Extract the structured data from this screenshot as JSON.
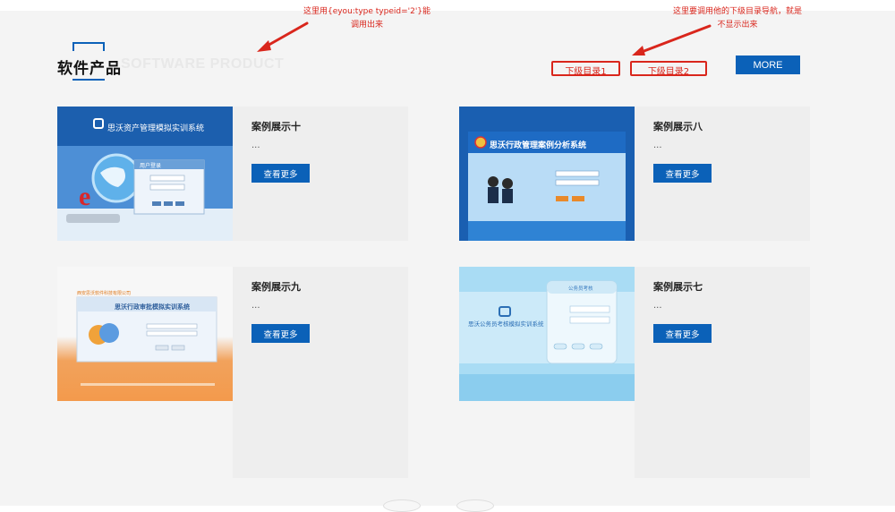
{
  "section": {
    "title_cn": "软件产品",
    "title_en": "SOFTWARE PRODUCT",
    "more_label": "MORE",
    "subnav": [
      "下级目录1",
      "下级目录2"
    ]
  },
  "annotations": {
    "left_note_line1": "这里用{eyou:type typeid='2'}能",
    "left_note_line2": "调用出来",
    "right_note_line1": "这里要调用他的下级目录导航，就是",
    "right_note_line2": "不显示出来"
  },
  "cards": [
    {
      "name": "案例展示十",
      "desc": "...",
      "button": "查看更多",
      "thumb_title": "思沃资产管理模拟实训系统",
      "login_title": "用户登录"
    },
    {
      "name": "案例展示八",
      "desc": "...",
      "button": "查看更多",
      "thumb_title": "思沃行政管理案例分析系统"
    },
    {
      "name": "案例展示九",
      "desc": "...",
      "button": "查看更多",
      "thumb_top_text": "西安思沃软件科技有限公司",
      "thumb_title": "思沃行政审批模拟实训系统"
    },
    {
      "name": "案例展示七",
      "desc": "...",
      "button": "查看更多",
      "thumb_title": "思沃公务员考核模拟实训系统",
      "login_title": "公务员考核"
    }
  ],
  "colors": {
    "primary": "#0b61b8",
    "annotation_red": "#d9261c",
    "panel_bg": "#eeeeee",
    "section_bg": "#f4f4f4"
  }
}
